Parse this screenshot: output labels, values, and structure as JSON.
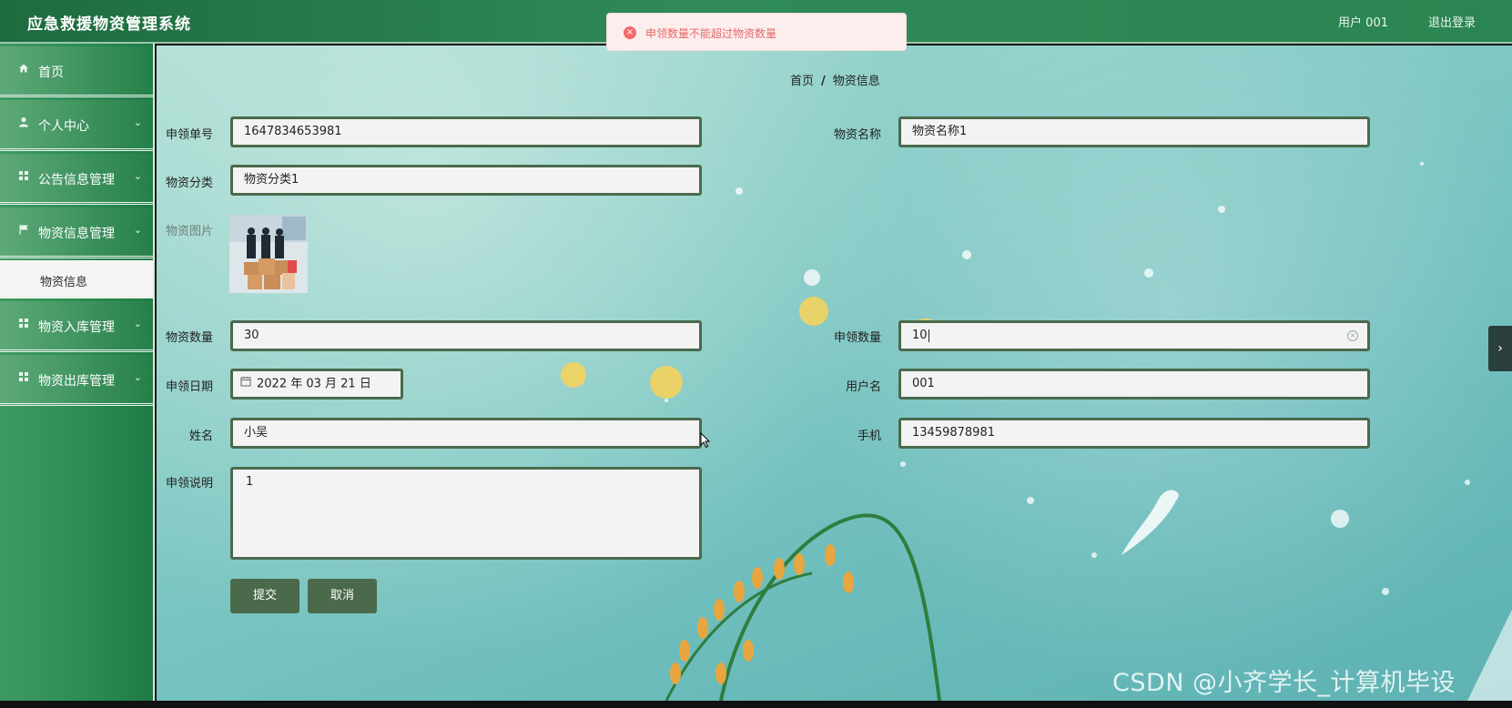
{
  "app": {
    "title": "应急救援物资管理系统",
    "user_label": "用户 001",
    "logout_label": "退出登录"
  },
  "toast": {
    "message": "申领数量不能超过物资数量",
    "icon": "error-circle-icon",
    "color": "#f26b6b"
  },
  "sidebar": {
    "items": [
      {
        "label": "首页",
        "icon": "home-icon",
        "expandable": false
      },
      {
        "label": "个人中心",
        "icon": "user-icon",
        "expandable": true
      },
      {
        "label": "公告信息管理",
        "icon": "grid-icon",
        "expandable": true
      },
      {
        "label": "物资信息管理",
        "icon": "flag-icon",
        "expandable": true
      },
      {
        "label": "物资入库管理",
        "icon": "grid-icon",
        "expandable": true
      },
      {
        "label": "物资出库管理",
        "icon": "grid-icon",
        "expandable": true
      }
    ],
    "sub_item": {
      "label": "物资信息",
      "active": true
    }
  },
  "breadcrumb": {
    "home": "首页",
    "separator": "/",
    "current": "物资信息"
  },
  "form": {
    "apply_no": {
      "label": "申领单号",
      "value": "1647834653981"
    },
    "material_name": {
      "label": "物资名称",
      "value": "物资名称1"
    },
    "material_category": {
      "label": "物资分类",
      "value": "物资分类1"
    },
    "material_image": {
      "label": "物资图片"
    },
    "material_qty": {
      "label": "物资数量",
      "value": "30"
    },
    "apply_qty": {
      "label": "申领数量",
      "value": "10"
    },
    "apply_date": {
      "label": "申领日期",
      "value": "2022 年 03 月 21 日"
    },
    "username": {
      "label": "用户名",
      "value": "001"
    },
    "name": {
      "label": "姓名",
      "value": "小吴"
    },
    "phone": {
      "label": "手机",
      "value": "13459878981"
    },
    "description": {
      "label": "申领说明",
      "value": "1"
    },
    "submit_label": "提交",
    "cancel_label": "取消"
  },
  "watermark": "CSDN @小齐学长_计算机毕设",
  "colors": {
    "header": "#2f8a57",
    "sidebar": "#2b8a52",
    "input_border": "#4b6a4d",
    "button": "#4b6a4b",
    "error": "#e06a6a"
  }
}
